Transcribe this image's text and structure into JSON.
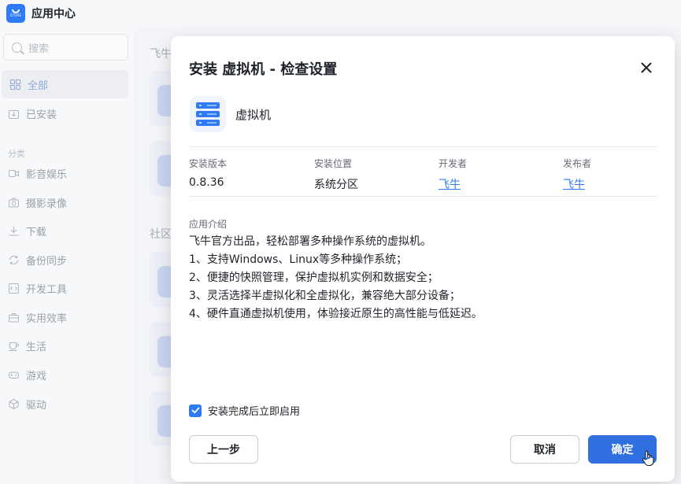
{
  "titlebar": {
    "app_title": "应用中心",
    "logo_text": "STORE"
  },
  "sidebar": {
    "search_placeholder": "搜索",
    "all_label": "全部",
    "installed_label": "已安装",
    "category_heading": "分类",
    "categories": [
      {
        "label": "影音娱乐",
        "icon": "video-icon"
      },
      {
        "label": "摄影录像",
        "icon": "camera-icon"
      },
      {
        "label": "下载",
        "icon": "download-icon"
      },
      {
        "label": "备份同步",
        "icon": "sync-icon"
      },
      {
        "label": "开发工具",
        "icon": "code-icon"
      },
      {
        "label": "实用效率",
        "icon": "toolbox-icon"
      },
      {
        "label": "生活",
        "icon": "coffee-icon"
      },
      {
        "label": "游戏",
        "icon": "gamepad-icon"
      },
      {
        "label": "驱动",
        "icon": "cube-icon"
      }
    ]
  },
  "background": {
    "section_official": "飞牛",
    "section_community": "社区"
  },
  "modal": {
    "title": "安装 虚拟机 - 检查设置",
    "app_name": "虚拟机",
    "info": {
      "version_label": "安装版本",
      "version_value": "0.8.36",
      "location_label": "安装位置",
      "location_value": "系统分区",
      "developer_label": "开发者",
      "developer_value": "飞牛",
      "publisher_label": "发布者",
      "publisher_value": "飞牛"
    },
    "description_label": "应用介绍",
    "description_lines": [
      "飞牛官方出品，轻松部署多种操作系统的虚拟机。",
      "1、支持Windows、Linux等多种操作系统；",
      "2、便捷的快照管理，保护虚拟机实例和数据安全；",
      "3、灵活选择半虚拟化和全虚拟化，兼容绝大部分设备；",
      "4、硬件直通虚拟机使用，体验接近原生的高性能与低延迟。"
    ],
    "checkbox_label": "安装完成后立即启用",
    "checkbox_checked": true,
    "prev_button": "上一步",
    "cancel_button": "取消",
    "confirm_button": "确定"
  },
  "colors": {
    "accent": "#2f7bf5",
    "primary_button": "#2f6fe0"
  }
}
